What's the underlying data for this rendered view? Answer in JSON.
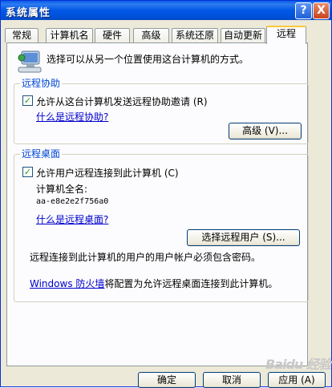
{
  "window": {
    "title": "系统属性",
    "help_label": "?",
    "close_label": "X"
  },
  "tabs": [
    "常规",
    "计算机名",
    "硬件",
    "高级",
    "系统还原",
    "自动更新",
    "远程"
  ],
  "active_tab": "远程",
  "intro_text": "选择可以从另一个位置使用这台计算机的方式。",
  "remote_assistance": {
    "title": "远程协助",
    "checkbox_label": "允许从这台计算机发送远程协助邀请 (R)",
    "checked": true,
    "link": "什么是远程协助?",
    "advanced_button": "高级 (V)..."
  },
  "remote_desktop": {
    "title": "远程桌面",
    "checkbox_label": "允许用户远程连接到此计算机 (C)",
    "checked": true,
    "fullname_label": "计算机全名:",
    "fullname_value": "aa-e8e2e2f756a0",
    "link": "什么是远程桌面?",
    "select_users_button": "选择远程用户 (S)...",
    "password_note": "远程连接到此计算机的用户的用户帐户必须包含密码。",
    "firewall_link": "Windows 防火墙",
    "firewall_text": "将配置为允许远程桌面连接到此计算机。"
  },
  "buttons": {
    "ok": "确定",
    "cancel": "取消",
    "apply": "应用 (A)"
  },
  "watermark": "Baidu 经验",
  "colors": {
    "titlebar": "#0058e6",
    "face": "#ece9d8",
    "group_title": "#0046d5",
    "link": "#0000cc"
  }
}
